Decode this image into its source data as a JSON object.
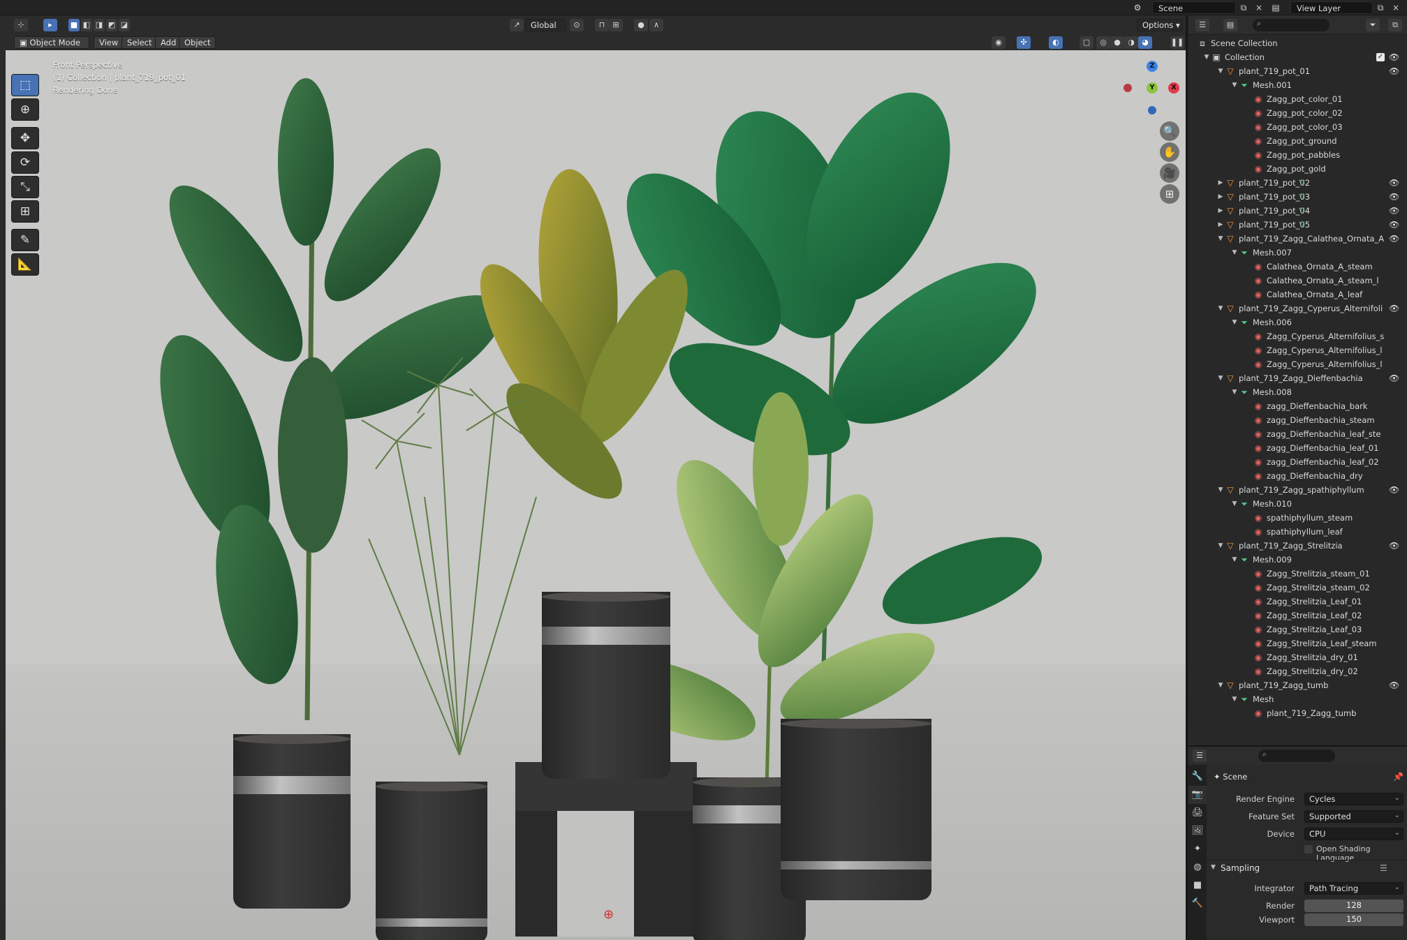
{
  "topbar": {
    "scene_label": "Scene",
    "view_layer_label": "View Layer"
  },
  "viewport": {
    "mode": "Object Mode",
    "menu": [
      "View",
      "Select",
      "Add",
      "Object"
    ],
    "transform_orientation": "Global",
    "options_label": "Options",
    "overlay_lines": [
      "Front Perspective",
      "(1) Collection | plant_719_pot_01",
      "Rendering Done"
    ],
    "gizmo": {
      "x": "X",
      "y": "Y",
      "z": "Z"
    }
  },
  "outliner": {
    "rows": [
      {
        "label": "Scene Collection",
        "kind": "scene",
        "depth": 0,
        "arrow": ""
      },
      {
        "label": "Collection",
        "kind": "collection",
        "depth": 1,
        "arrow": "down",
        "check": true,
        "eye": true
      },
      {
        "label": "plant_719_pot_01",
        "kind": "object",
        "depth": 2,
        "arrow": "down",
        "eye": true
      },
      {
        "label": "Mesh.001",
        "kind": "mesh",
        "depth": 3,
        "arrow": "down"
      },
      {
        "label": "Zagg_pot_color_01",
        "kind": "material",
        "depth": 4
      },
      {
        "label": "Zagg_pot_color_02",
        "kind": "material",
        "depth": 4
      },
      {
        "label": "Zagg_pot_color_03",
        "kind": "material",
        "depth": 4
      },
      {
        "label": "Zagg_pot_ground",
        "kind": "material",
        "depth": 4
      },
      {
        "label": "Zagg_pot_pabbles",
        "kind": "material",
        "depth": 4
      },
      {
        "label": "Zagg_pot_gold",
        "kind": "material",
        "depth": 4
      },
      {
        "label": "plant_719_pot_02",
        "kind": "object",
        "depth": 2,
        "arrow": "right",
        "eye": true,
        "side": true
      },
      {
        "label": "plant_719_pot_03",
        "kind": "object",
        "depth": 2,
        "arrow": "right",
        "eye": true,
        "side": true
      },
      {
        "label": "plant_719_pot_04",
        "kind": "object",
        "depth": 2,
        "arrow": "right",
        "eye": true,
        "side": true
      },
      {
        "label": "plant_719_pot_05",
        "kind": "object",
        "depth": 2,
        "arrow": "right",
        "eye": true,
        "side": true
      },
      {
        "label": "plant_719_Zagg_Calathea_Ornata_A",
        "kind": "object",
        "depth": 2,
        "arrow": "down",
        "eye": true
      },
      {
        "label": "Mesh.007",
        "kind": "mesh",
        "depth": 3,
        "arrow": "down"
      },
      {
        "label": "Calathea_Ornata_A_steam",
        "kind": "material",
        "depth": 4
      },
      {
        "label": "Calathea_Ornata_A_steam_l",
        "kind": "material",
        "depth": 4
      },
      {
        "label": "Calathea_Ornata_A_leaf",
        "kind": "material",
        "depth": 4
      },
      {
        "label": "plant_719_Zagg_Cyperus_Alternifoli",
        "kind": "object",
        "depth": 2,
        "arrow": "down",
        "eye": true
      },
      {
        "label": "Mesh.006",
        "kind": "mesh",
        "depth": 3,
        "arrow": "down"
      },
      {
        "label": "Zagg_Cyperus_Alternifolius_s",
        "kind": "material",
        "depth": 4
      },
      {
        "label": "Zagg_Cyperus_Alternifolius_l",
        "kind": "material",
        "depth": 4
      },
      {
        "label": "Zagg_Cyperus_Alternifolius_l",
        "kind": "material",
        "depth": 4
      },
      {
        "label": "plant_719_Zagg_Dieffenbachia",
        "kind": "object",
        "depth": 2,
        "arrow": "down",
        "eye": true
      },
      {
        "label": "Mesh.008",
        "kind": "mesh",
        "depth": 3,
        "arrow": "down"
      },
      {
        "label": "zagg_Dieffenbachia_bark",
        "kind": "material",
        "depth": 4
      },
      {
        "label": "zagg_Dieffenbachia_steam",
        "kind": "material",
        "depth": 4
      },
      {
        "label": "zagg_Dieffenbachia_leaf_ste",
        "kind": "material",
        "depth": 4
      },
      {
        "label": "zagg_Dieffenbachia_leaf_01",
        "kind": "material",
        "depth": 4
      },
      {
        "label": "zagg_Dieffenbachia_leaf_02",
        "kind": "material",
        "depth": 4
      },
      {
        "label": "zagg_Dieffenbachia_dry",
        "kind": "material",
        "depth": 4
      },
      {
        "label": "plant_719_Zagg_spathiphyllum",
        "kind": "object",
        "depth": 2,
        "arrow": "down",
        "eye": true
      },
      {
        "label": "Mesh.010",
        "kind": "mesh",
        "depth": 3,
        "arrow": "down"
      },
      {
        "label": "spathiphyllum_steam",
        "kind": "material",
        "depth": 4
      },
      {
        "label": "spathiphyllum_leaf",
        "kind": "material",
        "depth": 4
      },
      {
        "label": "plant_719_Zagg_Strelitzia",
        "kind": "object",
        "depth": 2,
        "arrow": "down",
        "eye": true
      },
      {
        "label": "Mesh.009",
        "kind": "mesh",
        "depth": 3,
        "arrow": "down"
      },
      {
        "label": "Zagg_Strelitzia_steam_01",
        "kind": "material",
        "depth": 4
      },
      {
        "label": "Zagg_Strelitzia_steam_02",
        "kind": "material",
        "depth": 4
      },
      {
        "label": "Zagg_Strelitzia_Leaf_01",
        "kind": "material",
        "depth": 4
      },
      {
        "label": "Zagg_Strelitzia_Leaf_02",
        "kind": "material",
        "depth": 4
      },
      {
        "label": "Zagg_Strelitzia_Leaf_03",
        "kind": "material",
        "depth": 4
      },
      {
        "label": "Zagg_Strelitzia_Leaf_steam",
        "kind": "material",
        "depth": 4
      },
      {
        "label": "Zagg_Strelitzia_dry_01",
        "kind": "material",
        "depth": 4
      },
      {
        "label": "Zagg_Strelitzia_dry_02",
        "kind": "material",
        "depth": 4
      },
      {
        "label": "plant_719_Zagg_tumb",
        "kind": "object",
        "depth": 2,
        "arrow": "down",
        "eye": true
      },
      {
        "label": "Mesh",
        "kind": "mesh",
        "depth": 3,
        "arrow": "down"
      },
      {
        "label": "plant_719_Zagg_tumb",
        "kind": "material",
        "depth": 4
      }
    ]
  },
  "properties": {
    "context": "Scene",
    "render_engine_label": "Render Engine",
    "render_engine": "Cycles",
    "feature_set_label": "Feature Set",
    "feature_set": "Supported",
    "device_label": "Device",
    "device": "CPU",
    "osl_label": "Open Shading Language",
    "sampling_label": "Sampling",
    "integrator_label": "Integrator",
    "integrator": "Path Tracing",
    "render_label": "Render",
    "render_samples": "128",
    "viewport_label": "Viewport",
    "viewport_samples": "150"
  },
  "colors": {
    "accent": "#4772b3",
    "object": "#f29a3d",
    "mesh": "#58c68a",
    "material": "#e06262",
    "axis_x": "#e23a4b",
    "axis_y": "#8ac63a",
    "axis_z": "#3b83e6"
  }
}
